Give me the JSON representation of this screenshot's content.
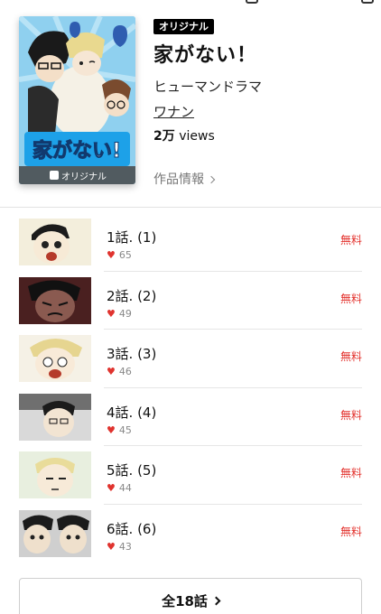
{
  "series": {
    "badge": "オリジナル",
    "title": "家がない！",
    "genre": "ヒューマンドラマ",
    "author": "ワナン",
    "views_value": "2万",
    "views_unit": " views",
    "info_link": "作品情報",
    "cover_badge": "オリジナル",
    "cover_logo": "家がない!"
  },
  "episodes": [
    {
      "title": "1話. (1)",
      "likes": "65",
      "price": "無料"
    },
    {
      "title": "2話. (2)",
      "likes": "49",
      "price": "無料"
    },
    {
      "title": "3話. (3)",
      "likes": "46",
      "price": "無料"
    },
    {
      "title": "4話. (4)",
      "likes": "45",
      "price": "無料"
    },
    {
      "title": "5話. (5)",
      "likes": "44",
      "price": "無料"
    },
    {
      "title": "6話. (6)",
      "likes": "43",
      "price": "無料"
    }
  ],
  "footer": {
    "all_label": "全18話"
  },
  "colors": {
    "accent_red": "#e3342f",
    "heart": "#e0332e",
    "badge_bg": "#000000"
  }
}
